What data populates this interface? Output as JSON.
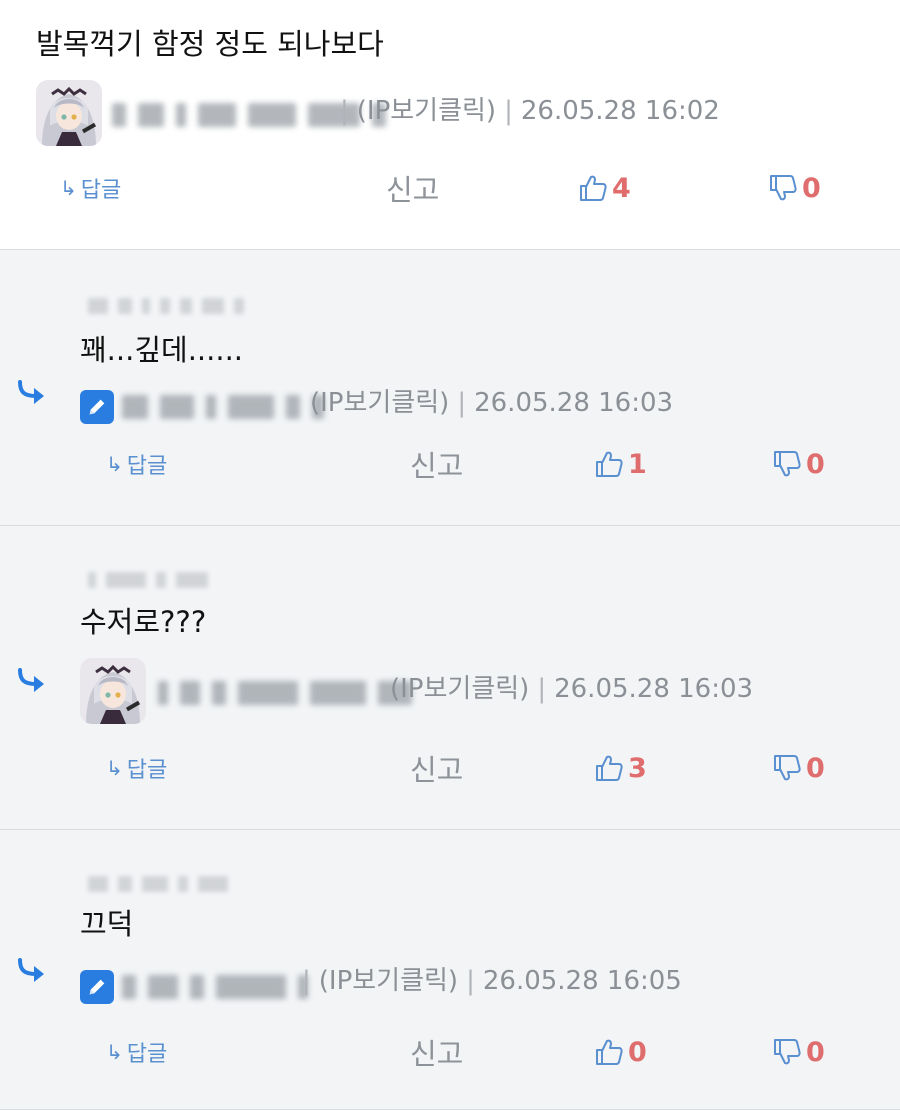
{
  "comments": [
    {
      "type": "top",
      "body": "발목꺽기 함정 정도 되나보다",
      "author_blurred": true,
      "meta_ip": "(IP보기클릭)",
      "timestamp": "26.05.28 16:02",
      "reply_label": "답글",
      "report_label": "신고",
      "upvotes": "4",
      "downvotes": "0",
      "avatar_icon": "anime-avatar-icon"
    },
    {
      "type": "reply",
      "body": "꽤...깊데......",
      "meta_ip": "(IP보기클릭)",
      "timestamp": "26.05.28 16:03",
      "reply_label": "답글",
      "report_label": "신고",
      "upvotes": "1",
      "downvotes": "0",
      "avatar_icon": "pencil-icon"
    },
    {
      "type": "reply",
      "body": "수저로???",
      "meta_ip": "(IP보기클릭)",
      "timestamp": "26.05.28 16:03",
      "reply_label": "답글",
      "report_label": "신고",
      "upvotes": "3",
      "downvotes": "0",
      "avatar_icon": "anime-avatar-icon"
    },
    {
      "type": "reply",
      "body": "끄덕",
      "meta_ip": "(IP보기클릭)",
      "timestamp": "26.05.28 16:05",
      "reply_label": "답글",
      "report_label": "신고",
      "upvotes": "0",
      "downvotes": "0",
      "avatar_icon": "pencil-icon"
    }
  ],
  "colors": {
    "accent": "#2a7de0",
    "vote_count": "#e06d6d",
    "meta": "#8b9096",
    "reply_bg": "#f2f4f6"
  }
}
